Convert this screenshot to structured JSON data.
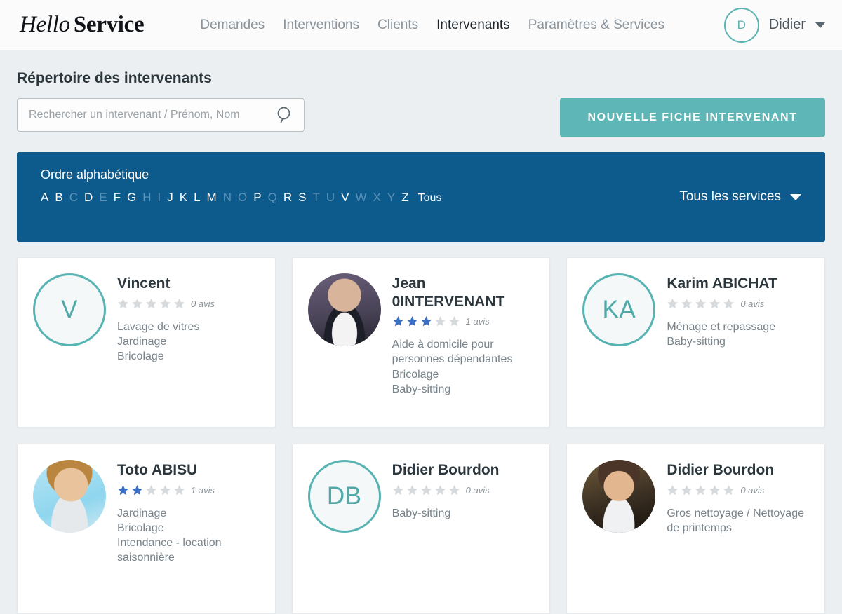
{
  "header": {
    "logo": {
      "part1": "Hello",
      "part2": "Service"
    },
    "nav": [
      {
        "label": "Demandes",
        "active": false
      },
      {
        "label": "Interventions",
        "active": false
      },
      {
        "label": "Clients",
        "active": false
      },
      {
        "label": "Intervenants",
        "active": true
      },
      {
        "label": "Paramètres & Services",
        "active": false
      }
    ],
    "user": {
      "initial": "D",
      "name": "Didier"
    }
  },
  "page": {
    "title": "Répertoire des intervenants",
    "search_placeholder": "Rechercher un intervenant / Prénom, Nom",
    "search_value": "",
    "new_button": "NOUVELLE FICHE INTERVENANT"
  },
  "alpha_bar": {
    "title": "Ordre alphabétique",
    "letters": [
      {
        "label": "A",
        "enabled": true
      },
      {
        "label": "B",
        "enabled": true
      },
      {
        "label": "C",
        "enabled": false
      },
      {
        "label": "D",
        "enabled": true
      },
      {
        "label": "E",
        "enabled": false
      },
      {
        "label": "F",
        "enabled": true
      },
      {
        "label": "G",
        "enabled": true
      },
      {
        "label": "H",
        "enabled": false
      },
      {
        "label": "I",
        "enabled": false
      },
      {
        "label": "J",
        "enabled": true
      },
      {
        "label": "K",
        "enabled": true
      },
      {
        "label": "L",
        "enabled": true
      },
      {
        "label": "M",
        "enabled": true
      },
      {
        "label": "N",
        "enabled": false
      },
      {
        "label": "O",
        "enabled": false
      },
      {
        "label": "P",
        "enabled": true
      },
      {
        "label": "Q",
        "enabled": false
      },
      {
        "label": "R",
        "enabled": true
      },
      {
        "label": "S",
        "enabled": true
      },
      {
        "label": "T",
        "enabled": false
      },
      {
        "label": "U",
        "enabled": false
      },
      {
        "label": "V",
        "enabled": true
      },
      {
        "label": "W",
        "enabled": false
      },
      {
        "label": "X",
        "enabled": false
      },
      {
        "label": "Y",
        "enabled": false
      },
      {
        "label": "Z",
        "enabled": true
      },
      {
        "label": "Tous",
        "enabled": true
      }
    ],
    "services_filter": "Tous les services"
  },
  "cards": [
    {
      "name": "Vincent",
      "avatar_type": "initials",
      "initials": "V",
      "rating": 0,
      "stars_total": 5,
      "reviews": "0 avis",
      "services": [
        "Lavage de vitres",
        "Jardinage",
        "Bricolage"
      ]
    },
    {
      "name": "Jean 0INTERVENANT",
      "avatar_type": "photo",
      "photo_class": "ph-jean",
      "rating": 3,
      "stars_total": 5,
      "reviews": "1 avis",
      "services": [
        "Aide à domicile pour personnes dépendantes",
        "Bricolage",
        "Baby-sitting"
      ]
    },
    {
      "name": "Karim ABICHAT",
      "avatar_type": "initials",
      "initials": "KA",
      "rating": 0,
      "stars_total": 5,
      "reviews": "0 avis",
      "services": [
        "Ménage et repassage",
        "Baby-sitting"
      ]
    },
    {
      "name": "Toto ABISU",
      "avatar_type": "photo",
      "photo_class": "ph-toto",
      "rating": 2,
      "stars_total": 5,
      "reviews": "1 avis",
      "services": [
        "Jardinage",
        "Bricolage",
        "Intendance - location saisonnière"
      ]
    },
    {
      "name": "Didier Bourdon",
      "avatar_type": "initials",
      "initials": "DB",
      "rating": 0,
      "stars_total": 5,
      "reviews": "0 avis",
      "services": [
        "Baby-sitting"
      ]
    },
    {
      "name": "Didier Bourdon",
      "avatar_type": "photo",
      "photo_class": "ph-didier",
      "rating": 0,
      "stars_total": 5,
      "reviews": "0 avis",
      "services": [
        "Gros nettoyage / Nettoyage de printemps"
      ]
    }
  ],
  "colors": {
    "teal": "#5fb6b6",
    "blue_bar": "#0d5a8c",
    "star_filled": "#3b6fc4",
    "star_empty": "#d6dadd",
    "page_bg": "#eceff1"
  }
}
